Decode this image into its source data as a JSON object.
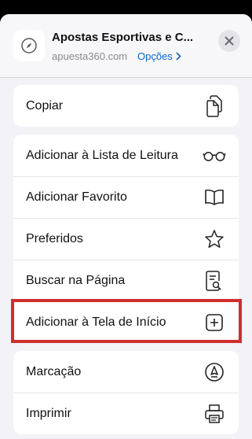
{
  "header": {
    "site_title": "Apostas Esportivas e C...",
    "site_url": "apuesta360.com",
    "options_label": "Opções"
  },
  "groups": [
    {
      "items": [
        {
          "label": "Copiar",
          "icon": "copy-icon"
        }
      ]
    },
    {
      "items": [
        {
          "label": "Adicionar à Lista de Leitura",
          "icon": "glasses-icon"
        },
        {
          "label": "Adicionar Favorito",
          "icon": "book-icon"
        },
        {
          "label": "Preferidos",
          "icon": "star-icon"
        },
        {
          "label": "Buscar na Página",
          "icon": "find-on-page-icon"
        },
        {
          "label": "Adicionar à Tela de Início",
          "icon": "add-square-icon"
        }
      ]
    },
    {
      "items": [
        {
          "label": "Marcação",
          "icon": "markup-icon"
        },
        {
          "label": "Imprimir",
          "icon": "printer-icon"
        }
      ]
    }
  ],
  "colors": {
    "accent": "#0a66d8",
    "highlight": "#d12e2e",
    "sheet_background": "#f2f2f7"
  }
}
